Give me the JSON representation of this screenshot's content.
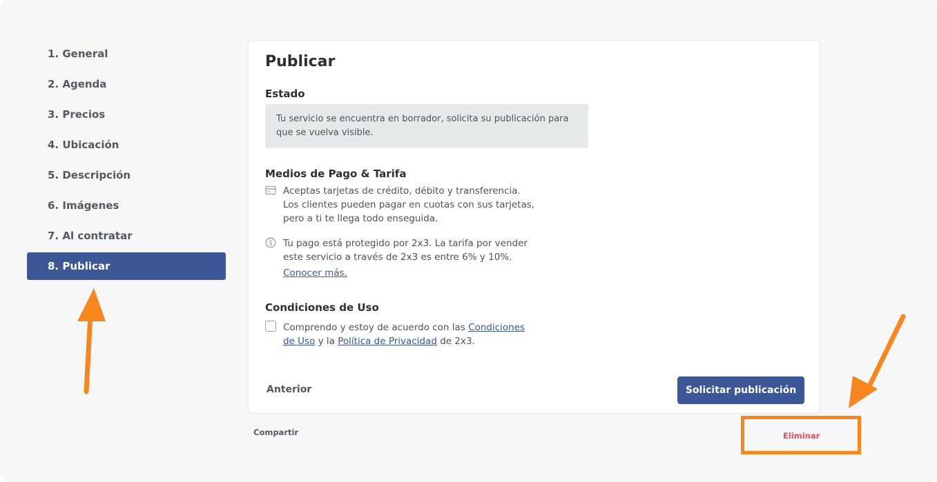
{
  "sidebar": {
    "items": [
      {
        "label": "1. General"
      },
      {
        "label": "2. Agenda"
      },
      {
        "label": "3. Precios"
      },
      {
        "label": "4. Ubicación"
      },
      {
        "label": "5. Descripción"
      },
      {
        "label": "6. Imágenes"
      },
      {
        "label": "7. Al contratar"
      },
      {
        "label": "8. Publicar",
        "active": true
      }
    ]
  },
  "main": {
    "title": "Publicar",
    "estado": {
      "heading": "Estado",
      "message": "Tu servicio se encuentra en borrador, solicita su publicación para que se vuelva visible."
    },
    "pago": {
      "heading": "Medios de Pago & Tarifa",
      "card_text": "Aceptas tarjetas de crédito, débito y transferencia. Los clientes pueden pagar en cuotas con sus tarjetas, pero a ti te llega todo enseguida.",
      "protect_text": "Tu pago está protegido por 2x3. La tarifa por vender este servicio a través de 2x3 es entre 6% y 10%.",
      "learn_more": "Conocer más."
    },
    "condiciones": {
      "heading": "Condiciones de Uso",
      "text_before": "Comprendo y estoy de acuerdo con las ",
      "terms_link": "Condiciones de Uso",
      "text_mid": " y la ",
      "privacy_link": "Política de Privacidad",
      "text_after": " de 2x3."
    },
    "prev_label": "Anterior",
    "submit_label": "Solicitar publicación"
  },
  "footer": {
    "share_label": "Compartir",
    "delete_label": "Eliminar"
  },
  "icons": {
    "card": "credit-card-icon",
    "money": "dollar-coin-icon"
  },
  "colors": {
    "accent": "#3b5795",
    "danger": "#e0505a",
    "annotation": "#f7861f"
  }
}
